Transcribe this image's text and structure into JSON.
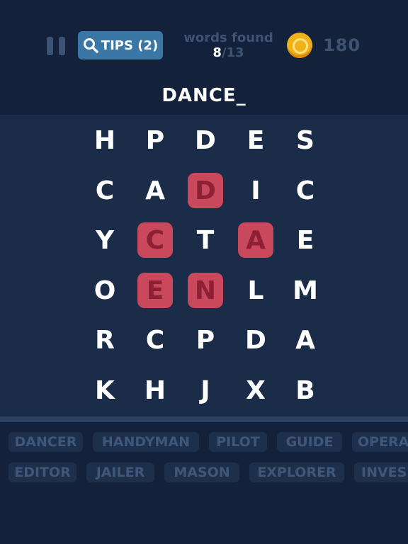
{
  "header": {
    "tips_label": "TIPS (2)",
    "words_found_label": "words found",
    "words_found_current": "8",
    "words_found_total": "/13",
    "coins": "180"
  },
  "current_word": "DANCE_",
  "grid": [
    [
      "H",
      "P",
      "D",
      "E",
      "S"
    ],
    [
      "C",
      "A",
      "D",
      "I",
      "C"
    ],
    [
      "Y",
      "C",
      "T",
      "A",
      "E"
    ],
    [
      "O",
      "E",
      "N",
      "L",
      "M"
    ],
    [
      "R",
      "C",
      "P",
      "D",
      "A"
    ],
    [
      "K",
      "H",
      "J",
      "X",
      "B"
    ]
  ],
  "selected_cells": [
    "1-2",
    "2-1",
    "2-3",
    "3-1",
    "3-2"
  ],
  "word_list": {
    "row1": [
      "DANCER",
      "HANDYMAN",
      "PILOT",
      "GUIDE",
      "OPERA"
    ],
    "row2": [
      "EDITOR",
      "JAILER",
      "MASON",
      "EXPLORER",
      "INVES"
    ]
  },
  "colors": {
    "background": "#14213a",
    "board": "#1b2c49",
    "selection": "#c9485b",
    "tips_button": "#3a77a4",
    "coin": "#f0b21b",
    "muted_text": "#3e5373"
  },
  "icons": [
    "pause-icon",
    "search-icon",
    "coin-icon"
  ]
}
